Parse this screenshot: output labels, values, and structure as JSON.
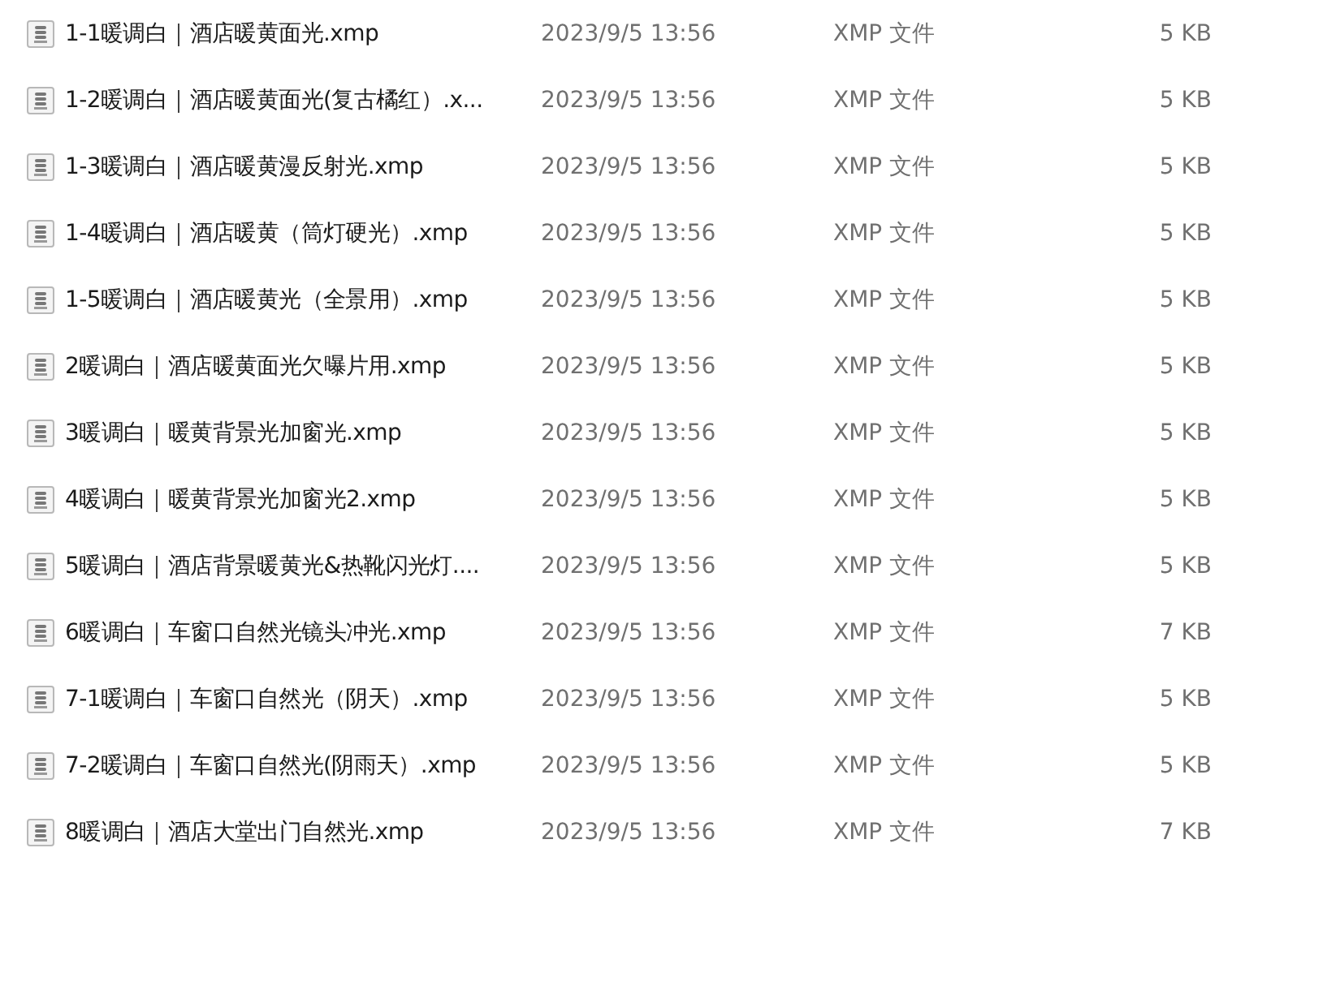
{
  "files": [
    {
      "name": "1-1暖调白｜酒店暖黄面光.xmp",
      "modified": "2023/9/5 13:56",
      "type": "XMP 文件",
      "size": "5 KB"
    },
    {
      "name": "1-2暖调白｜酒店暖黄面光(复古橘红）.x...",
      "modified": "2023/9/5 13:56",
      "type": "XMP 文件",
      "size": "5 KB"
    },
    {
      "name": "1-3暖调白｜酒店暖黄漫反射光.xmp",
      "modified": "2023/9/5 13:56",
      "type": "XMP 文件",
      "size": "5 KB"
    },
    {
      "name": "1-4暖调白｜酒店暖黄（筒灯硬光）.xmp",
      "modified": "2023/9/5 13:56",
      "type": "XMP 文件",
      "size": "5 KB"
    },
    {
      "name": "1-5暖调白｜酒店暖黄光（全景用）.xmp",
      "modified": "2023/9/5 13:56",
      "type": "XMP 文件",
      "size": "5 KB"
    },
    {
      "name": "2暖调白｜酒店暖黄面光欠曝片用.xmp",
      "modified": "2023/9/5 13:56",
      "type": "XMP 文件",
      "size": "5 KB"
    },
    {
      "name": "3暖调白｜暖黄背景光加窗光.xmp",
      "modified": "2023/9/5 13:56",
      "type": "XMP 文件",
      "size": "5 KB"
    },
    {
      "name": "4暖调白｜暖黄背景光加窗光2.xmp",
      "modified": "2023/9/5 13:56",
      "type": "XMP 文件",
      "size": "5 KB"
    },
    {
      "name": "5暖调白｜酒店背景暖黄光&热靴闪光灯....",
      "modified": "2023/9/5 13:56",
      "type": "XMP 文件",
      "size": "5 KB"
    },
    {
      "name": "6暖调白｜车窗口自然光镜头冲光.xmp",
      "modified": "2023/9/5 13:56",
      "type": "XMP 文件",
      "size": "7 KB"
    },
    {
      "name": "7-1暖调白｜车窗口自然光（阴天）.xmp",
      "modified": "2023/9/5 13:56",
      "type": "XMP 文件",
      "size": "5 KB"
    },
    {
      "name": "7-2暖调白｜车窗口自然光(阴雨天）.xmp",
      "modified": "2023/9/5 13:56",
      "type": "XMP 文件",
      "size": "5 KB"
    },
    {
      "name": "8暖调白｜酒店大堂出门自然光.xmp",
      "modified": "2023/9/5 13:56",
      "type": "XMP 文件",
      "size": "7 KB"
    }
  ]
}
